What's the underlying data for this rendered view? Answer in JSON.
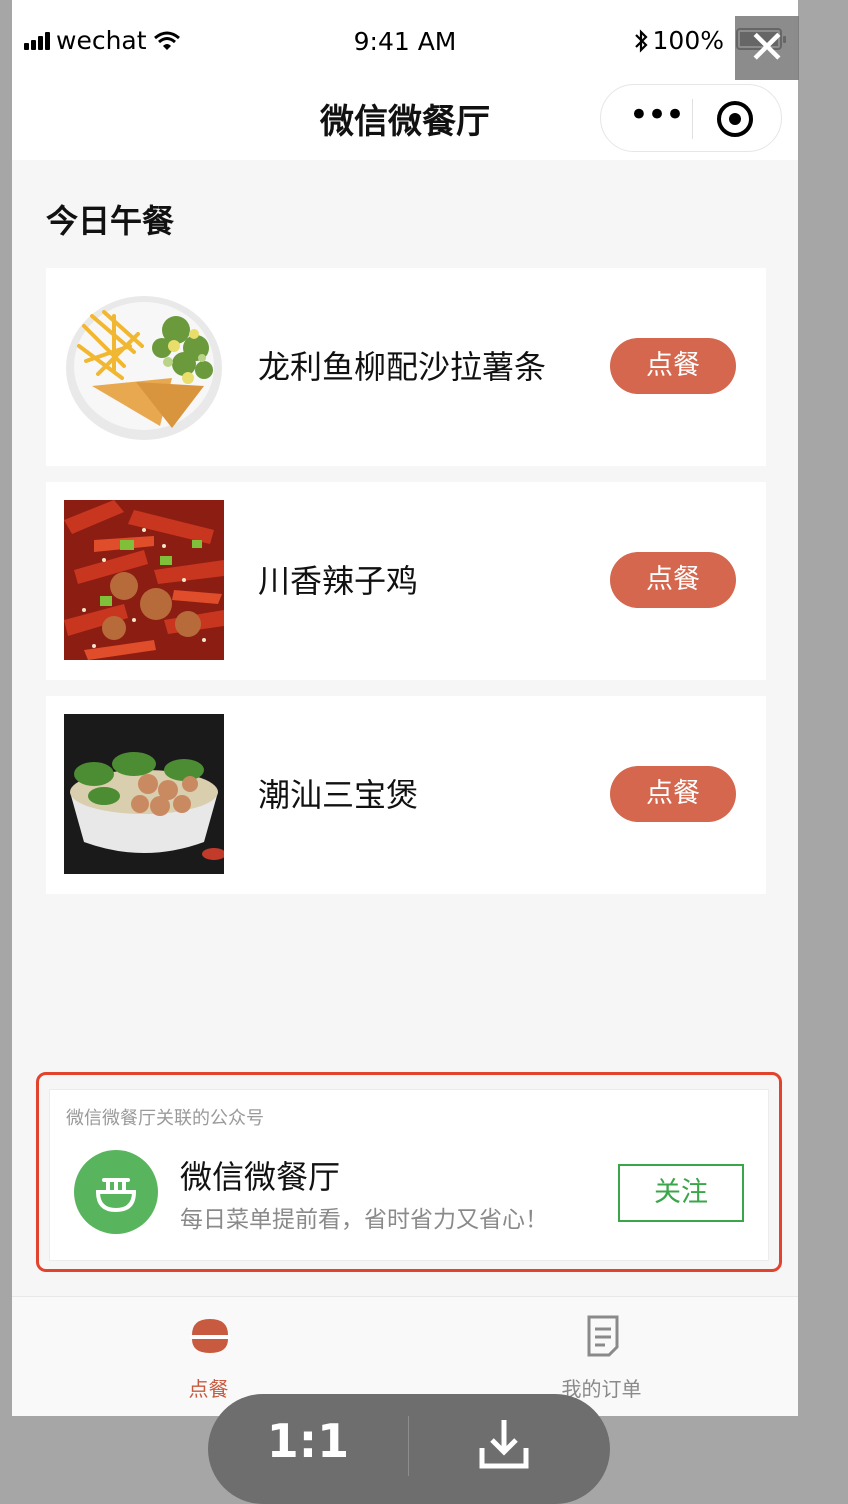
{
  "status_bar": {
    "carrier": "wechat",
    "time": "9:41 AM",
    "battery": "100%"
  },
  "nav": {
    "title": "微信微餐厅"
  },
  "section": {
    "title": "今日午餐"
  },
  "dishes": [
    {
      "name": "龙利鱼柳配沙拉薯条",
      "button": "点餐"
    },
    {
      "name": "川香辣子鸡",
      "button": "点餐"
    },
    {
      "name": "潮汕三宝煲",
      "button": "点餐"
    }
  ],
  "official_account": {
    "caption": "微信微餐厅关联的公众号",
    "name": "微信微餐厅",
    "description": "每日菜单提前看，省时省力又省心！",
    "follow_label": "关注"
  },
  "tab_bar": {
    "tabs": [
      {
        "label": "点餐",
        "active": true
      },
      {
        "label": "我的订单",
        "active": false
      }
    ]
  },
  "viewer": {
    "ratio_label": "1:1"
  },
  "colors": {
    "accent_order": "#d4674d",
    "follow_green": "#3aa64a",
    "highlight_red": "#e2432c",
    "tab_active": "#c85a3f",
    "tab_inactive": "#8a8a8a"
  }
}
